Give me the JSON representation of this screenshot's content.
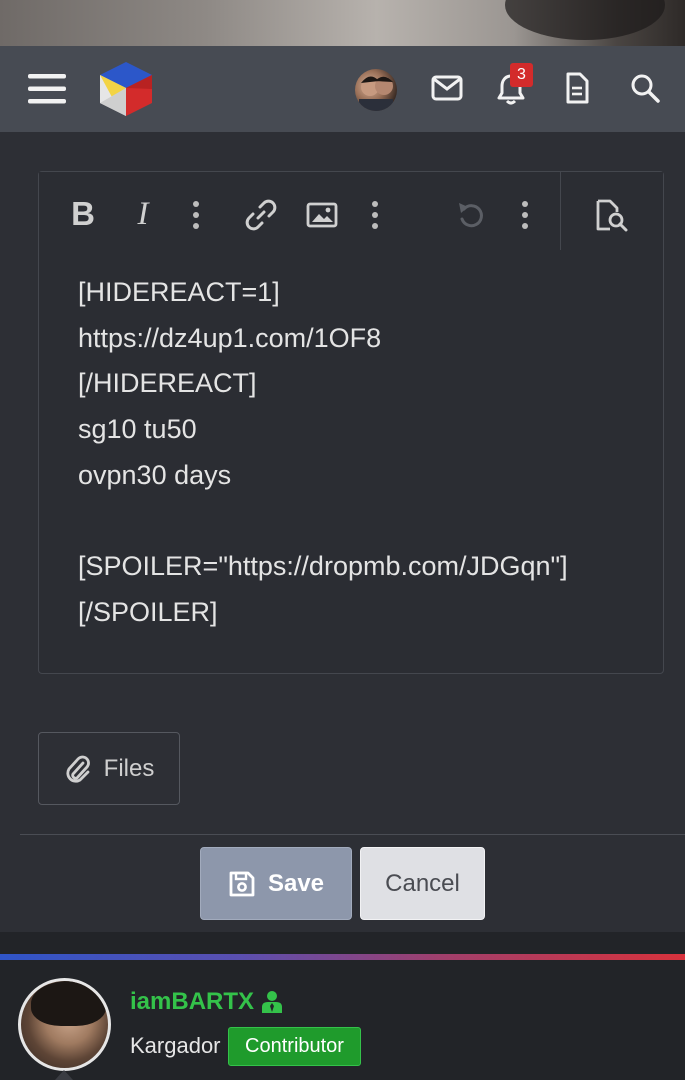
{
  "nav": {
    "menu_icon": "hamburger-menu-icon",
    "logo_icon": "site-logo-cube",
    "notifications_count": "3"
  },
  "editor": {
    "toolbar": {
      "bold_label": "B",
      "italic_label": "I"
    },
    "lines": [
      "[HIDEREACT=1]",
      "https://dz4up1.com/1OF8",
      "[/HIDEREACT]",
      "sg10 tu50",
      "ovpn30 days",
      "",
      "[SPOILER=\"https://dropmb.com/JDGqn\"]",
      "[/SPOILER]"
    ]
  },
  "attachments": {
    "files_label": "Files"
  },
  "actions": {
    "save_label": "Save",
    "cancel_label": "Cancel"
  },
  "user": {
    "username": "iamBARTX",
    "title": "Kargador",
    "role_badge": "Contributor"
  },
  "colors": {
    "navbar": "#474b53",
    "save_button": "#8d97ab",
    "cancel_button": "#dfe0e4",
    "username": "#34c24a",
    "role_badge": "#1f9b2c",
    "notification_badge": "#d32b2b"
  }
}
